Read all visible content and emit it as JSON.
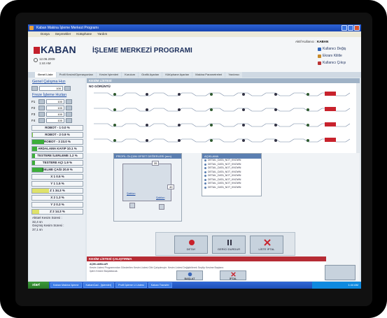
{
  "window": {
    "title": "Kaban Makina İşleme Merkezi Programı"
  },
  "menu": [
    "Dosya",
    "Seçenekler",
    "Kütüphane",
    "Yardım"
  ],
  "header": {
    "logo": "KABAN",
    "app_title": "İŞLEME MERKEZİ PROGRAMI",
    "date": "12.06.2009",
    "time": "1:44 AM",
    "user_label": "Aktif Kullanıcı :",
    "user_name": "KABAN",
    "links": [
      "Kullanıcı Değiş",
      "Ekranı Kilitle",
      "Kullanıcı Çıkışı"
    ]
  },
  "tabs": [
    "Genel Liste",
    "Profil Kesimi/Operasyonları",
    "Kesim İşlemleri",
    "Kurulum",
    "Grafik Ayarları",
    "Kütüphane Ayarları",
    "Makina Parametreleri",
    "Yardımcı"
  ],
  "left": {
    "genel_title": "Genel Çalışma Hızı",
    "genel_value": "100",
    "freze_title": "Freze İşleme Hızları",
    "freze_rows": [
      {
        "label": "F1",
        "value": "100"
      },
      {
        "label": "F2",
        "value": "100"
      },
      {
        "label": "F3",
        "value": "100"
      },
      {
        "label": "F4",
        "value": "100"
      }
    ],
    "meters": [
      {
        "label": "ROBOT - 1 0.0 %",
        "fill": 0.0,
        "color": "#7acb3b"
      },
      {
        "label": "ROBOT - 2 0.9 %",
        "fill": 0.02,
        "color": "#7acb3b"
      },
      {
        "label": "ROBOT - 3 23.0 %",
        "fill": 0.23,
        "color": "#3dae3a"
      },
      {
        "label": "ARDALAMA KAYIP 10.1 %",
        "fill": 0.1,
        "color": "#3dae3a"
      },
      {
        "label": "TESTERE İLERLEME 1.2 %",
        "fill": 0.05,
        "color": "#3dae3a"
      },
      {
        "label": "TESTERE AÇI 1.9 %",
        "fill": 0.05,
        "color": "#3dae3a"
      },
      {
        "label": "DELME ÇAĞI 20.9 %",
        "fill": 0.22,
        "color": "#3dae3a"
      },
      {
        "label": "X 1 0.5 %",
        "fill": 0.0,
        "color": "#7acb3b"
      },
      {
        "label": "Y 1 1.5 %",
        "fill": 0.0,
        "color": "#7acb3b"
      },
      {
        "label": "Z 1 34.3 %",
        "fill": 0.34,
        "color": "#dfe26a"
      },
      {
        "label": "X 2 1.3 %",
        "fill": 0.0,
        "color": "#7acb3b"
      },
      {
        "label": "Y 2 0.3 %",
        "fill": 0.0,
        "color": "#7acb3b"
      },
      {
        "label": "Z 2 14.3 %",
        "fill": 0.14,
        "color": "#dfe26a"
      }
    ],
    "info": [
      "Aktüel Kesim Süresi :",
      "32,4 sn",
      "Geçmiş Kesim Süresi :",
      "37,1 sn"
    ]
  },
  "main": {
    "list_title": "KESİM LİSTESİ",
    "cut_title": "NO GÖRÜNTÜ",
    "profile_title": "PROFİL ÖLÇÜM OFSET DEĞERLERİ (mm)",
    "profile_top": "35",
    "profile_side": "40",
    "profile_left_label": "Şablon",
    "profile_right_label": "Şablon",
    "aciklama_title": "AÇIKLAMA",
    "aciklama_items": [
      "DETAIL_DATA_NOT_KNOWN",
      "DETAIL_DATA_NOT_KNOWN",
      "DETAIL_DATA_NOT_KNOWN",
      "DETAIL_DATA_NOT_KNOWN",
      "DETAIL_DATA_NOT_KNOWN",
      "DETAIL_DATA_NOT_KNOWN",
      "DETAIL_DATA_NOT_KNOWN",
      "DETAIL_DATA_NOT_KNOWN"
    ],
    "actions": [
      "DETAY",
      "GERİCİ DURDUR",
      "LİSTE İPTAL"
    ],
    "kesim_title": "KESİM LİSTESİ ÇALIŞTIRMA",
    "kesim_sub": "AÇIKLAMALAR",
    "kesim_desc": [
      "Kesim Listesi Programından Gönderilen Kesim Listesi Gibi Çalışılmıştır. Kesim Listesi Değiştirilerek Seçilip Kesime Başlanır.",
      "İşlem Kesimi Başlatılacak."
    ],
    "kesim_buttons": [
      "BAŞLAT",
      "İPTAL"
    ]
  },
  "taskbar": {
    "start": "start",
    "items": [
      "Kaban Makina İşleme",
      "KabanCad - [işlemler]",
      "Profil İşleme Li Listesi",
      "Kaban Transfer"
    ],
    "clock": "1:44 AM"
  }
}
